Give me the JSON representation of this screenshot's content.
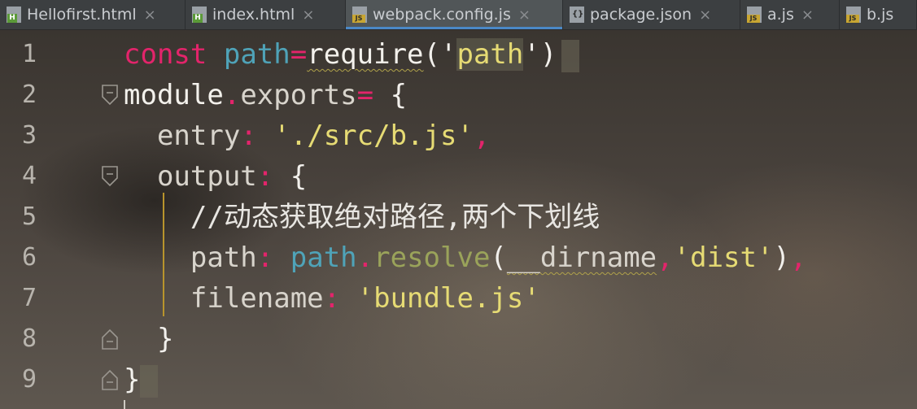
{
  "tabs": [
    {
      "label": "Hellofirst.html",
      "icon": "html-file-icon",
      "active": false,
      "closable": true
    },
    {
      "label": "index.html",
      "icon": "html-file-icon",
      "active": false,
      "closable": true
    },
    {
      "label": "webpack.config.js",
      "icon": "js-file-icon",
      "active": true,
      "closable": true
    },
    {
      "label": "package.json",
      "icon": "json-file-icon",
      "active": false,
      "closable": true
    },
    {
      "label": "a.js",
      "icon": "js-file-icon",
      "active": false,
      "closable": true
    },
    {
      "label": "b.js",
      "icon": "js-file-icon",
      "active": false,
      "closable": false
    }
  ],
  "close_glyph": "×",
  "line_numbers": [
    "1",
    "2",
    "3",
    "4",
    "5",
    "6",
    "7",
    "8",
    "9"
  ],
  "code": {
    "l1": {
      "kw": "const",
      "var": "path",
      "op": "=",
      "fn": "require",
      "open": "('",
      "arg": "path",
      "close": "')"
    },
    "l2": {
      "obj": "module",
      "dot": ".",
      "prop": "exports",
      "op": "=",
      "brace": " {"
    },
    "l3": {
      "indent": "  ",
      "key": "entry",
      "colon": ":",
      "value": "'./src/b.js'",
      "comma": ","
    },
    "l4": {
      "indent": "  ",
      "key": "output",
      "colon": ":",
      "brace": " {"
    },
    "l5": {
      "indent": "    ",
      "comment": "//动态获取绝对路径,两个下划线"
    },
    "l6": {
      "indent": "    ",
      "key": "path",
      "colon": ":",
      "obj": "path",
      "dot": ".",
      "method": "resolve",
      "open": "(",
      "arg1": "__dirname",
      "comma1": ",",
      "arg2": "'dist'",
      "close": ")",
      "comma2": ","
    },
    "l7": {
      "indent": "    ",
      "key": "filename",
      "colon": ":",
      "value": "'bundle.js'"
    },
    "l8": {
      "indent": "  ",
      "brace": "}"
    },
    "l9": {
      "brace": "}"
    }
  },
  "colors": {
    "keyword": "#e3246b",
    "variable": "#4fa3b8",
    "string": "#e6db74",
    "method": "#9aa35a",
    "indent_guide": "#b8942c",
    "active_tab_underline": "#4a88c7"
  }
}
